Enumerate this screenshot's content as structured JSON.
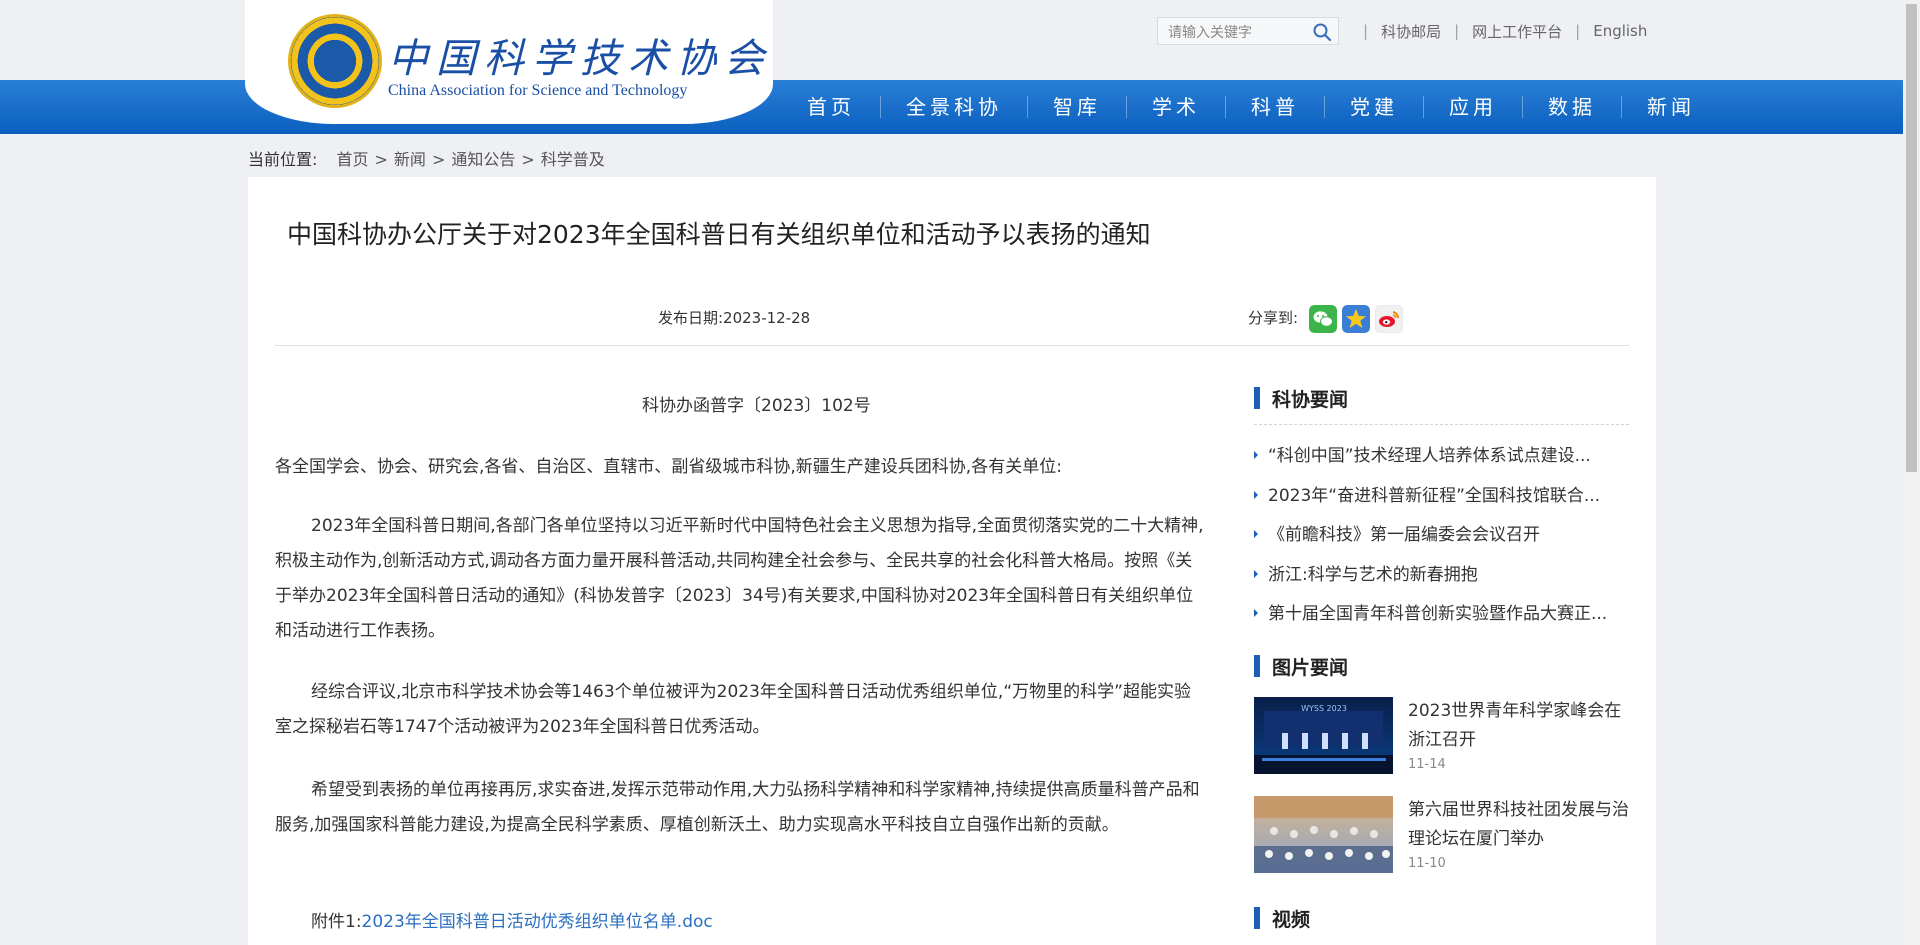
{
  "header": {
    "logo_cn": "中国科学技术协会",
    "logo_en": "China Association for Science and Technology",
    "search_placeholder": "请输入关键字",
    "top_links": [
      "科协邮局",
      "网上工作平台",
      "English"
    ],
    "nav": [
      "首页",
      "全景科协",
      "智库",
      "学术",
      "科普",
      "党建",
      "应用",
      "数据",
      "新闻"
    ]
  },
  "breadcrumb": {
    "label": "当前位置:",
    "items": [
      "首页",
      "新闻",
      "通知公告",
      "科学普及"
    ]
  },
  "article": {
    "title": "中国科协办公厅关于对2023年全国科普日有关组织单位和活动予以表扬的通知",
    "date": "发布日期:2023-12-28",
    "share_label": "分享到:",
    "share_icons": [
      "wechat-icon",
      "qzone-icon",
      "weibo-icon"
    ],
    "doc_number": "科协办函普字〔2023〕102号",
    "addressee": "各全国学会、协会、研究会,各省、自治区、直辖市、副省级城市科协,新疆生产建设兵团科协,各有关单位:",
    "paragraphs": [
      "2023年全国科普日期间,各部门各单位坚持以习近平新时代中国特色社会主义思想为指导,全面贯彻落实党的二十大精神,积极主动作为,创新活动方式,调动各方面力量开展科普活动,共同构建全社会参与、全民共享的社会化科普大格局。按照《关于举办2023年全国科普日活动的通知》(科协发普字〔2023〕34号)有关要求,中国科协对2023年全国科普日有关组织单位和活动进行工作表扬。",
      "经综合评议,北京市科学技术协会等1463个单位被评为2023年全国科普日活动优秀组织单位,“万物里的科学”超能实验室之探秘岩石等1747个活动被评为2023年全国科普日优秀活动。",
      "希望受到表扬的单位再接再厉,求实奋进,发挥示范带动作用,大力弘扬科学精神和科学家精神,持续提供高质量科普产品和服务,加强国家科普能力建设,为提高全民科学素质、厚植创新沃土、助力实现高水平科技自立自强作出新的贡献。"
    ],
    "attachment_label": "附件1:",
    "attachment_link": "2023年全国科普日活动优秀组织单位名单.doc"
  },
  "sidebar": {
    "news_heading": "科协要闻",
    "news": [
      "“科创中国”技术经理人培养体系试点建设...",
      "2023年“奋进科普新征程”全国科技馆联合...",
      "《前瞻科技》第一届编委会会议召开",
      "浙江:科学与艺术的新春拥抱",
      "第十届全国青年科普创新实验暨作品大赛正..."
    ],
    "pics_heading": "图片要闻",
    "pics": [
      {
        "title": "2023世界青年科学家峰会在浙江召开",
        "date": "11-14"
      },
      {
        "title": "第六届世界科技社团发展与治理论坛在厦门举办",
        "date": "11-10"
      }
    ],
    "video_heading": "视频"
  }
}
